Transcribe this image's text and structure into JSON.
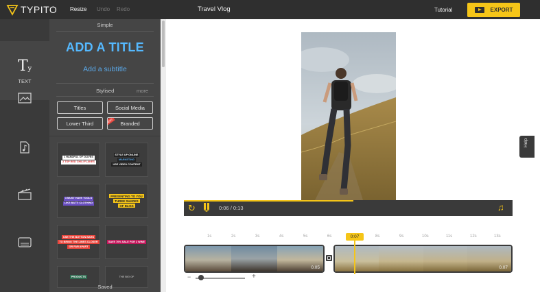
{
  "app": {
    "logo_text": "TYPITO",
    "project_title": "Travel Vlog"
  },
  "toolbar": {
    "resize": "Resize",
    "undo": "Undo",
    "redo": "Redo",
    "tutorial": "Tutorial",
    "export": "EXPORT"
  },
  "sidebar": {
    "items": [
      {
        "name": "text",
        "label": "TEXT",
        "icon": "text-icon",
        "active": true
      },
      {
        "name": "image",
        "icon": "image-icon"
      },
      {
        "name": "music",
        "icon": "music-file-icon"
      },
      {
        "name": "clip",
        "icon": "clapperboard-icon"
      },
      {
        "name": "caption",
        "icon": "caption-icon"
      }
    ]
  },
  "text_panel": {
    "simple_header": "Simple",
    "add_title": "ADD A TITLE",
    "add_subtitle": "Add a subtitle",
    "stylised_header": "Stylised",
    "more": "more",
    "categories": [
      "Titles",
      "Social Media",
      "Lower Third",
      "Branded"
    ],
    "new_badge": "NEW",
    "templates": [
      {
        "lines": [
          "1 HANDFUL OF OLIVES",
          "2 TSP RED CHILI FLAKES"
        ]
      },
      {
        "lines": [
          "STYLE UP ONLINE",
          "MARKETING",
          "USE VIDEO CONTENT"
        ]
      },
      {
        "lines": [
          "3 MUST HAVE TOOLS",
          "LIKE BATTI CLOTHING"
        ]
      },
      {
        "lines": [
          "PRESENTING TO YOU",
          "THREE SHADES",
          "OF BLISS"
        ]
      },
      {
        "lines": [
          "USE THE BUTTON BARS",
          "TO BRING THE LINES CLOSER",
          "OR FAR APART"
        ]
      },
      {
        "lines": [
          "SAVE 70% SALE FOR 2 WINE"
        ]
      },
      {
        "lines": [
          "PRODUCTS"
        ]
      },
      {
        "lines": [
          "THE BIG OF"
        ]
      }
    ],
    "saved": "Saved"
  },
  "player": {
    "current_time": "0:06",
    "separator": "/",
    "total_time": "0:13",
    "progress": 0.46
  },
  "help": "Help",
  "timeline": {
    "ticks": [
      "1s",
      "2s",
      "3s",
      "4s",
      "5s",
      "6s",
      "7s",
      "8s",
      "9s",
      "10s",
      "11s",
      "12s",
      "13s"
    ],
    "playhead": "0:07",
    "clips": [
      {
        "name": "clip-1",
        "duration": "0.05"
      },
      {
        "name": "clip-2",
        "duration": "0.07"
      }
    ],
    "zoom_minus": "−",
    "zoom_plus": "+"
  },
  "colors": {
    "accent": "#f5c518",
    "title_blue": "#55b9ff",
    "dark": "#2f2f2f",
    "panel": "#454545"
  }
}
